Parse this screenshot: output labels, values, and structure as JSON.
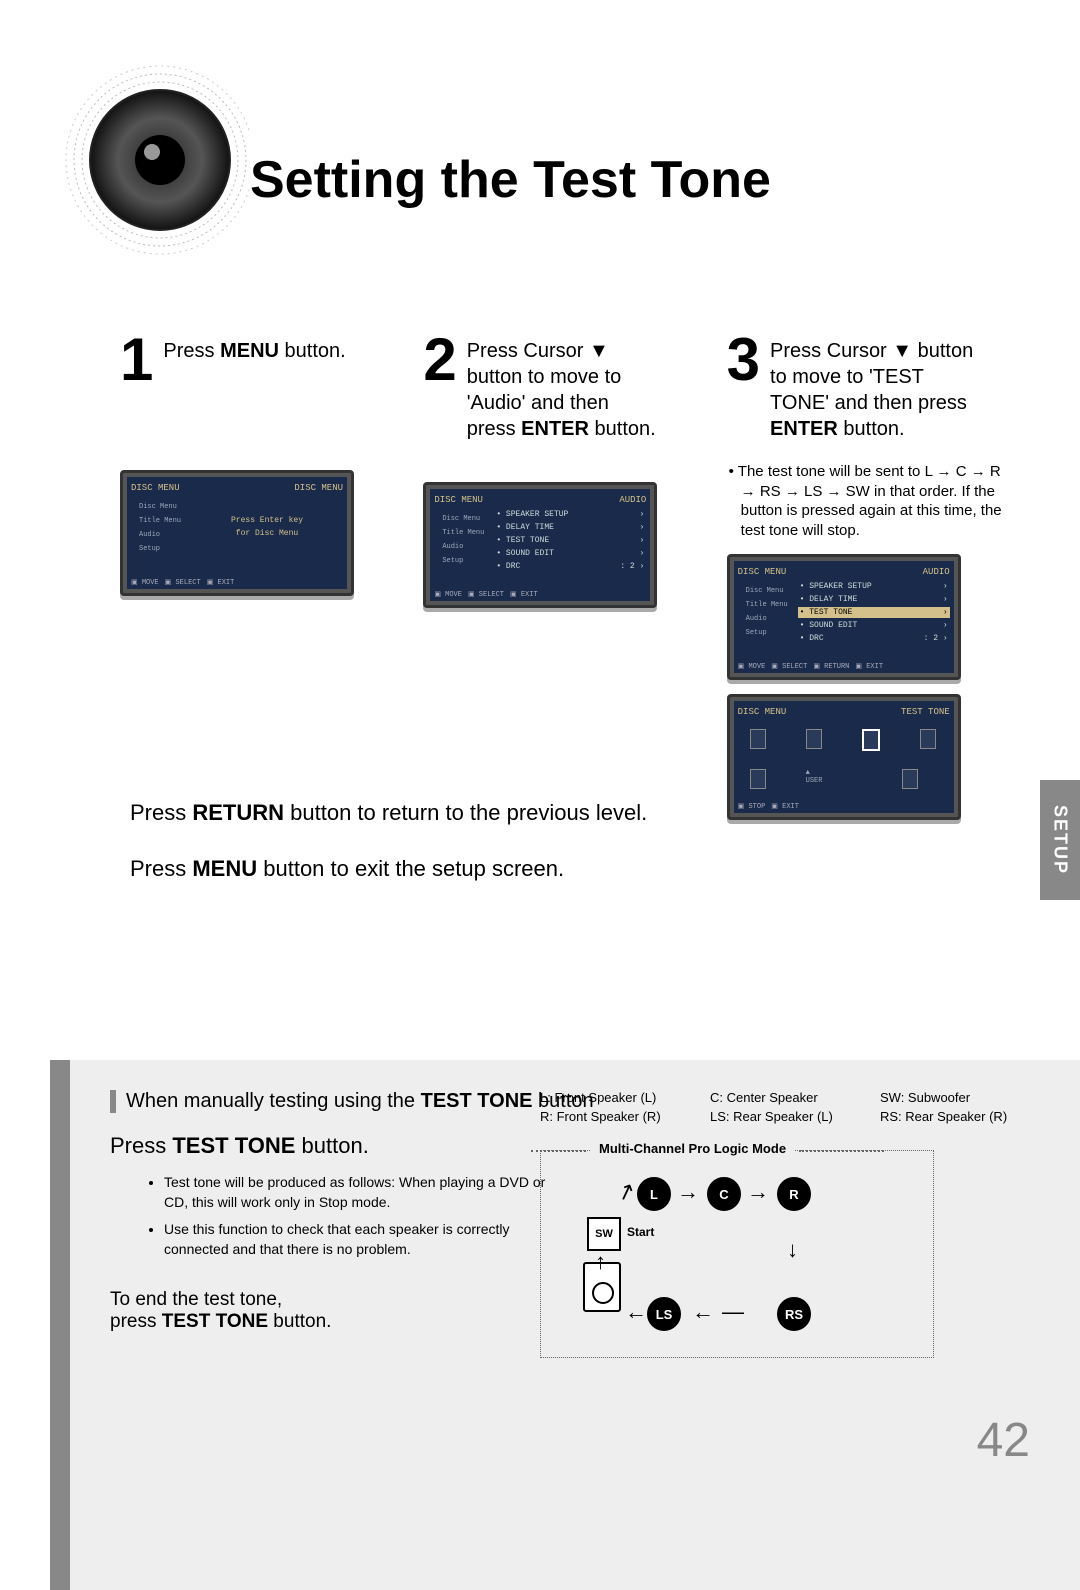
{
  "title": "Setting the Test Tone",
  "side_tab": "SETUP",
  "page_number": "42",
  "steps": {
    "s1": {
      "num": "1",
      "text_before": "Press ",
      "text_bold": "MENU",
      "text_after": " button."
    },
    "s2": {
      "num": "2",
      "line1": "Press Cursor ▼",
      "line2": "button to move to",
      "line3": "'Audio' and then",
      "line4_before": "press ",
      "line4_bold": "ENTER",
      "line4_after": " button."
    },
    "s3": {
      "num": "3",
      "line1": "Press Cursor ▼ button",
      "line2": "to move to 'TEST",
      "line3": "TONE' and then press",
      "line4_bold": "ENTER",
      "line4_after": " button."
    }
  },
  "note3": "• The test tone will be sent to L → C → R → RS → LS → SW in that order. If the button is pressed again at this time, the test tone will stop.",
  "tv1": {
    "hl": "DISC MENU",
    "hr": "DISC MENU",
    "sidebar": [
      "Disc Menu",
      "Title Menu",
      "Audio",
      "Setup"
    ],
    "center1": "Press Enter key",
    "center2": "for Disc Menu",
    "footer": [
      "MOVE",
      "SELECT",
      "EXIT"
    ]
  },
  "tv2": {
    "hl": "DISC MENU",
    "hr": "AUDIO",
    "sidebar": [
      "Disc Menu",
      "Title Menu",
      "Audio",
      "Setup"
    ],
    "items": [
      {
        "l": "• SPEAKER SETUP",
        "r": "›"
      },
      {
        "l": "• DELAY TIME",
        "r": "›"
      },
      {
        "l": "• TEST TONE",
        "r": "›"
      },
      {
        "l": "• SOUND EDIT",
        "r": "›"
      },
      {
        "l": "• DRC",
        "r": ": 2        ›"
      }
    ],
    "footer": [
      "MOVE",
      "SELECT",
      "EXIT"
    ]
  },
  "tv3": {
    "hl": "DISC MENU",
    "hr": "AUDIO",
    "sidebar": [
      "Disc Menu",
      "Title Menu",
      "Audio",
      "Setup"
    ],
    "items": [
      {
        "l": "• SPEAKER SETUP",
        "r": "›",
        "hl": false
      },
      {
        "l": "• DELAY TIME",
        "r": "›",
        "hl": false
      },
      {
        "l": "• TEST TONE",
        "r": "›",
        "hl": true
      },
      {
        "l": "• SOUND EDIT",
        "r": "›",
        "hl": false
      },
      {
        "l": "• DRC",
        "r": ": 2        ›",
        "hl": false
      }
    ],
    "footer": [
      "MOVE",
      "SELECT",
      "RETURN",
      "EXIT"
    ]
  },
  "tv4": {
    "hl": "DISC MENU",
    "hr": "TEST TONE",
    "footer": [
      "STOP",
      "EXIT"
    ]
  },
  "mid": {
    "l1_before": "Press ",
    "l1_bold": "RETURN",
    "l1_after": " button to return to the previous level.",
    "l2_before": "Press ",
    "l2_bold": "MENU",
    "l2_after": " button to exit the setup screen."
  },
  "bottom": {
    "heading_before": "When manually testing using the ",
    "heading_bold": "TEST TONE",
    "heading_after": " button",
    "sub_before": "Press ",
    "sub_bold": "TEST TONE",
    "sub_after": " button.",
    "bullets": [
      "Test tone will be produced as follows: When playing a DVD or CD, this will work only in Stop mode.",
      "Use this function to check that each speaker is correctly connected and that there is no problem."
    ],
    "end_l1": "To end the test tone,",
    "end_l2_before": "press ",
    "end_l2_bold": "TEST TONE",
    "end_l2_after": " button."
  },
  "legend": {
    "a": "L: Front Speaker (L)",
    "b": "C: Center Speaker",
    "c": "SW: Subwoofer",
    "d": "R: Front Speaker (R)",
    "e": "LS: Rear Speaker (L)",
    "f": "RS: Rear Speaker (R)"
  },
  "diagram": {
    "title": "Multi-Channel Pro Logic Mode",
    "L": "L",
    "C": "C",
    "R": "R",
    "SW": "SW",
    "LS": "LS",
    "RS": "RS",
    "start": "Start"
  }
}
